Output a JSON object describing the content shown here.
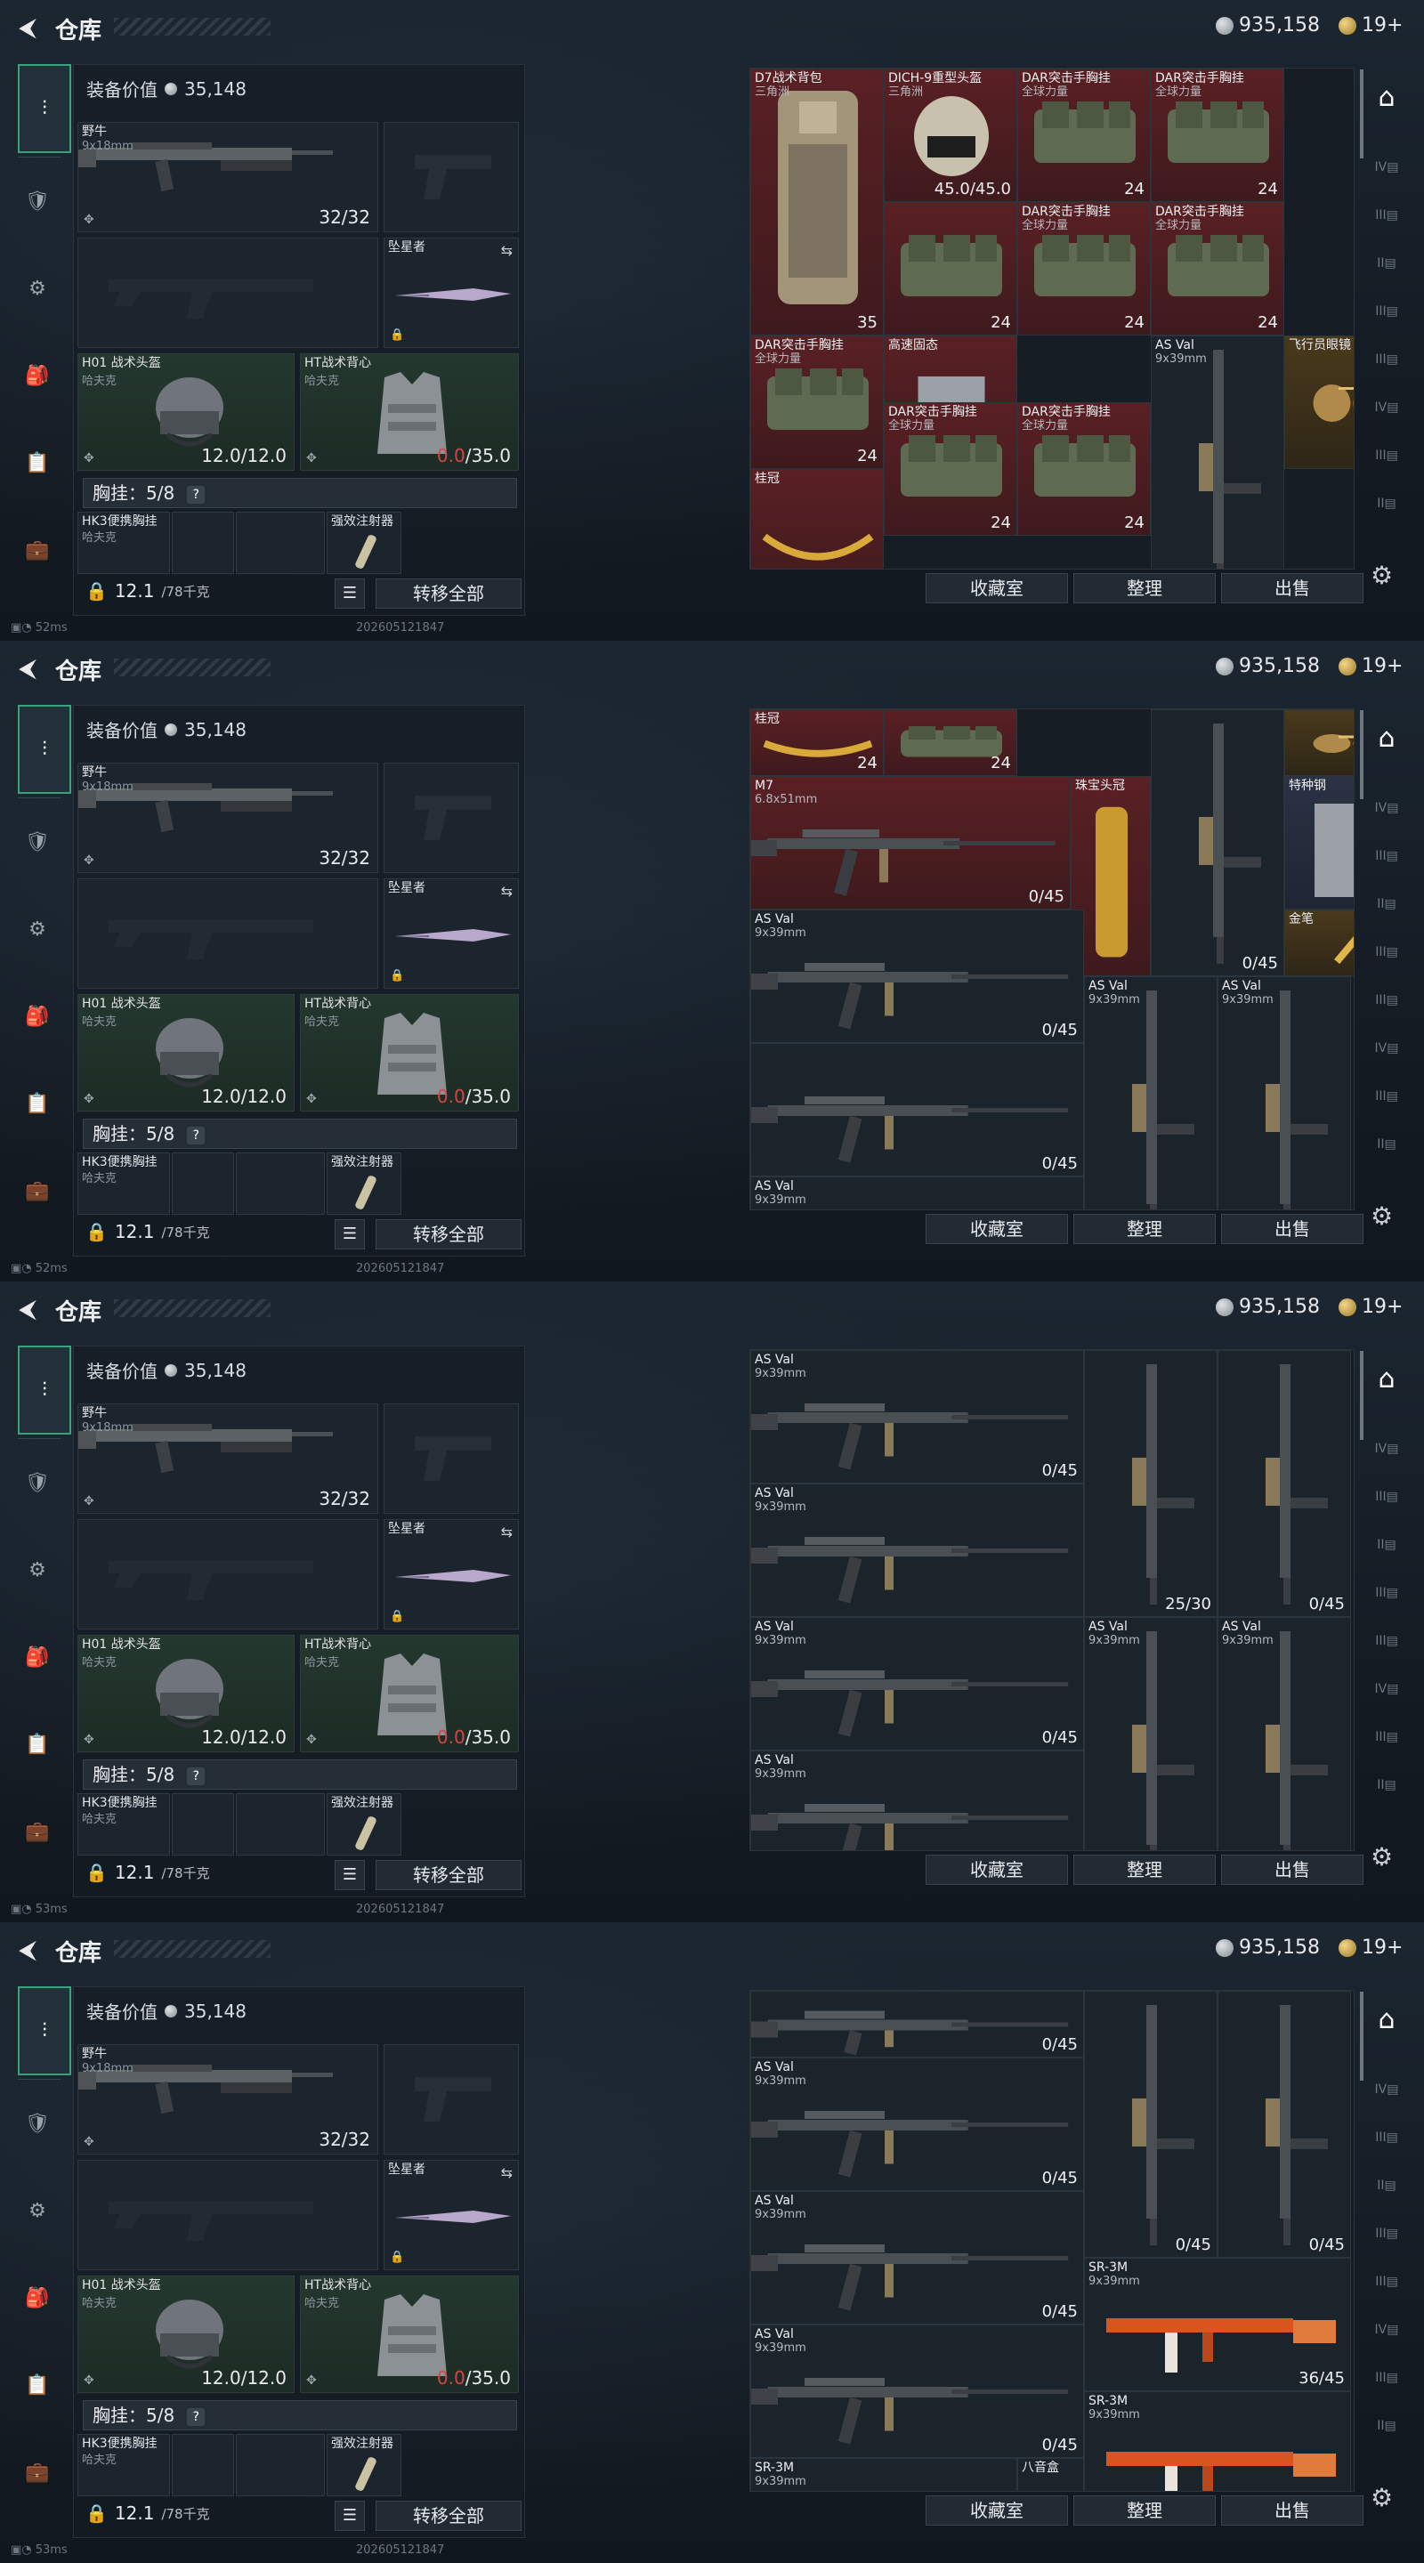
{
  "app": {
    "title": "仓库",
    "currency": "935,158",
    "tokens": "19+"
  },
  "left": {
    "value_label": "装备价值",
    "value": "35,148",
    "primary": {
      "name": "野牛",
      "caliber": "9x18mm",
      "ammo": "32/32"
    },
    "melee": {
      "name": "坠星者"
    },
    "helmet": {
      "name": "H01 战术头盔",
      "brand": "哈夫克",
      "dur": "12.0/12.0"
    },
    "armor": {
      "name": "HT战术背心",
      "brand": "哈夫克",
      "dur_cur": "0.0",
      "dur_max": "/35.0"
    },
    "rig": {
      "label": "胸挂：",
      "count": "5/8",
      "q": "?"
    },
    "rig_items": [
      {
        "name": "HK3便携胸挂",
        "brand": "哈夫克"
      },
      {
        "name": "强效注射器"
      }
    ],
    "weight": "12.1",
    "weight_max": "/78千克",
    "transfer_all": "转移全部"
  },
  "actions": {
    "collection": "收藏室",
    "sort": "整理",
    "sell": "出售"
  },
  "status": [
    {
      "ping": "52ms",
      "stamp": "202605121847"
    },
    {
      "ping": "52ms",
      "stamp": "202605121847"
    },
    {
      "ping": "53ms",
      "stamp": "202605121847"
    },
    {
      "ping": "53ms",
      "stamp": "202605121847"
    }
  ],
  "frames": [
    [
      {
        "c": 0,
        "r": 0,
        "w": 1,
        "h": 2,
        "n": "D7战术背包",
        "n2": "三角洲",
        "k": "red",
        "pic": "pack",
        "ct": "35"
      },
      {
        "c": 1,
        "r": 0,
        "w": 1,
        "h": 1,
        "n": "DICH-9重型头盔",
        "n2": "三角洲",
        "k": "red",
        "pic": "helmet",
        "ct": "45.0/45.0"
      },
      {
        "c": 2,
        "r": 0,
        "w": 1,
        "h": 1,
        "n": "DAR突击手胸挂",
        "n2": "全球力量",
        "k": "red",
        "pic": "bag",
        "ct": "24"
      },
      {
        "c": 3,
        "r": 0,
        "w": 1,
        "h": 1,
        "n": "DAR突击手胸挂",
        "n2": "全球力量",
        "k": "red",
        "pic": "bag",
        "ct": "24"
      },
      {
        "c": 2,
        "r": 1,
        "w": 1,
        "h": 1,
        "n": "DAR突击手胸挂",
        "n2": "全球力量",
        "k": "red",
        "pic": "bag",
        "ct": "24"
      },
      {
        "c": 3,
        "r": 1,
        "w": 1,
        "h": 1,
        "n": "DAR突击手胸挂",
        "n2": "全球力量",
        "k": "red",
        "pic": "bag",
        "ct": "24"
      },
      {
        "c": 1,
        "r": 1,
        "w": 1,
        "h": 1,
        "n": "",
        "n2": "",
        "k": "red",
        "pic": "bag",
        "ct": "24"
      },
      {
        "c": 0,
        "r": 2,
        "w": 1,
        "h": 1,
        "n": "DAR突击手胸挂",
        "n2": "全球力量",
        "k": "red",
        "pic": "bag",
        "ct": "24"
      },
      {
        "c": 1,
        "r": 2,
        "w": 1,
        "h": 1,
        "n": "高速固态",
        "n2": "",
        "k": "red",
        "pic": "drive",
        "ct": ""
      },
      {
        "c": 1,
        "r": 2.5,
        "w": 1,
        "h": 1,
        "n": "DAR突击手胸挂",
        "n2": "全球力量",
        "k": "red",
        "pic": "bag",
        "ct": "24"
      },
      {
        "c": 2,
        "r": 2.5,
        "w": 1,
        "h": 1,
        "n": "DAR突击手胸挂",
        "n2": "全球力量",
        "k": "red",
        "pic": "bag",
        "ct": "24"
      },
      {
        "c": 3,
        "r": 2,
        "w": 1,
        "h": 2,
        "n": "AS Val",
        "n2": "9x39mm",
        "k": "plain",
        "pic": "vgun",
        "ct": ""
      },
      {
        "c": 4,
        "r": 2,
        "w": 1,
        "h": 1,
        "n": "飞行员眼镜",
        "n2": "",
        "k": "gold",
        "pic": "glasses",
        "ct": ""
      },
      {
        "c": 0,
        "r": 3,
        "w": 1,
        "h": 1,
        "n": "桂冠",
        "n2": "",
        "k": "red",
        "pic": "crown",
        "ct": ""
      },
      {
        "c": 0,
        "r": 4,
        "w": 2.5,
        "h": 1,
        "n": "M7",
        "n2": "6.8x51mm",
        "k": "red",
        "pic": "gun",
        "ct": ""
      },
      {
        "c": 2.5,
        "r": 4,
        "w": 0.7,
        "h": 1,
        "n": "珠宝头冠",
        "n2": "",
        "k": "red",
        "pic": "crown2",
        "ct": ""
      },
      {
        "c": 4,
        "r": 4,
        "w": 1,
        "h": 1,
        "n": "特种钢",
        "n2": "",
        "k": "blue",
        "pic": "steel",
        "ct": ""
      }
    ],
    [
      {
        "c": 0,
        "r": 0,
        "w": 1,
        "h": 0.5,
        "n": "桂冠",
        "n2": "",
        "k": "red",
        "pic": "crown",
        "ct": "24"
      },
      {
        "c": 1,
        "r": 0,
        "w": 1,
        "h": 0.5,
        "n": "",
        "n2": "",
        "k": "red",
        "pic": "bag",
        "ct": "24"
      },
      {
        "c": 3,
        "r": 0,
        "w": 1,
        "h": 2,
        "n": "",
        "n2": "",
        "k": "plain",
        "pic": "vgun",
        "ct": "0/45"
      },
      {
        "c": 4,
        "r": 0,
        "w": 1,
        "h": 0.5,
        "n": "",
        "n2": "",
        "k": "gold",
        "pic": "glasses",
        "ct": ""
      },
      {
        "c": 0,
        "r": 0.5,
        "w": 2.4,
        "h": 1,
        "n": "M7",
        "n2": "6.8x51mm",
        "k": "red",
        "pic": "gun",
        "ct": "0/45"
      },
      {
        "c": 2.4,
        "r": 0.5,
        "w": 0.6,
        "h": 1.5,
        "n": "珠宝头冠",
        "n2": "",
        "k": "red",
        "pic": "crown2",
        "ct": ""
      },
      {
        "c": 4,
        "r": 0.5,
        "w": 1,
        "h": 1,
        "n": "特种钢",
        "n2": "",
        "k": "blue",
        "pic": "steel",
        "ct": ""
      },
      {
        "c": 4,
        "r": 1.5,
        "w": 1,
        "h": 0.5,
        "n": "金笔",
        "n2": "",
        "k": "gold",
        "pic": "pen",
        "ct": ""
      },
      {
        "c": 0,
        "r": 1.5,
        "w": 2.5,
        "h": 1,
        "n": "AS Val",
        "n2": "9x39mm",
        "k": "plain",
        "pic": "gun",
        "ct": "0/45"
      },
      {
        "c": 2.5,
        "r": 2,
        "w": 1,
        "h": 2,
        "n": "AS Val",
        "n2": "9x39mm",
        "k": "plain",
        "pic": "vgun",
        "ct": ""
      },
      {
        "c": 3.5,
        "r": 2,
        "w": 1,
        "h": 2,
        "n": "AS Val",
        "n2": "9x39mm",
        "k": "plain",
        "pic": "vgun",
        "ct": ""
      },
      {
        "c": 0,
        "r": 2.5,
        "w": 2.5,
        "h": 1,
        "n": "",
        "n2": "",
        "k": "plain",
        "pic": "gun",
        "ct": "0/45"
      },
      {
        "c": 0,
        "r": 3.5,
        "w": 2.5,
        "h": 1,
        "n": "AS Val",
        "n2": "9x39mm",
        "k": "plain",
        "pic": "gun",
        "ct": ""
      }
    ],
    [
      {
        "c": 0,
        "r": 0,
        "w": 2.5,
        "h": 1,
        "n": "AS Val",
        "n2": "9x39mm",
        "k": "plain",
        "pic": "gun",
        "ct": "0/45"
      },
      {
        "c": 2.5,
        "r": 0,
        "w": 1,
        "h": 2,
        "n": "",
        "n2": "",
        "k": "plain",
        "pic": "vgun",
        "ct": "25/30"
      },
      {
        "c": 3.5,
        "r": 0,
        "w": 1,
        "h": 2,
        "n": "",
        "n2": "",
        "k": "plain",
        "pic": "vgun",
        "ct": "0/45"
      },
      {
        "c": 0,
        "r": 1,
        "w": 2.5,
        "h": 1,
        "n": "AS Val",
        "n2": "9x39mm",
        "k": "plain",
        "pic": "gun",
        "ct": ""
      },
      {
        "c": 0,
        "r": 2,
        "w": 2.5,
        "h": 1,
        "n": "AS Val",
        "n2": "9x39mm",
        "k": "plain",
        "pic": "gun",
        "ct": "0/45"
      },
      {
        "c": 2.5,
        "r": 2,
        "w": 1,
        "h": 2,
        "n": "AS Val",
        "n2": "9x39mm",
        "k": "plain",
        "pic": "vgun",
        "ct": ""
      },
      {
        "c": 3.5,
        "r": 2,
        "w": 1,
        "h": 2,
        "n": "AS Val",
        "n2": "9x39mm",
        "k": "plain",
        "pic": "vgun",
        "ct": ""
      },
      {
        "c": 0,
        "r": 3,
        "w": 2.5,
        "h": 1,
        "n": "AS Val",
        "n2": "9x39mm",
        "k": "plain",
        "pic": "gun",
        "ct": ""
      }
    ],
    [
      {
        "c": 0,
        "r": 0,
        "w": 2.5,
        "h": 0.5,
        "n": "",
        "n2": "",
        "k": "plain",
        "pic": "gun",
        "ct": "0/45"
      },
      {
        "c": 2.5,
        "r": 0,
        "w": 1,
        "h": 2,
        "n": "",
        "n2": "",
        "k": "plain",
        "pic": "vgun",
        "ct": "0/45"
      },
      {
        "c": 3.5,
        "r": 0,
        "w": 1,
        "h": 2,
        "n": "",
        "n2": "",
        "k": "plain",
        "pic": "vgun",
        "ct": "0/45"
      },
      {
        "c": 0,
        "r": 0.5,
        "w": 2.5,
        "h": 1,
        "n": "AS Val",
        "n2": "9x39mm",
        "k": "plain",
        "pic": "gun",
        "ct": "0/45"
      },
      {
        "c": 0,
        "r": 1.5,
        "w": 2.5,
        "h": 1,
        "n": "AS Val",
        "n2": "9x39mm",
        "k": "plain",
        "pic": "gun",
        "ct": "0/45"
      },
      {
        "c": 2.5,
        "r": 2,
        "w": 2,
        "h": 1,
        "n": "SR-3M",
        "n2": "9x39mm",
        "k": "plain",
        "pic": "orange",
        "ct": "36/45"
      },
      {
        "c": 0,
        "r": 2.5,
        "w": 2.5,
        "h": 1,
        "n": "AS Val",
        "n2": "9x39mm",
        "k": "plain",
        "pic": "gun",
        "ct": "0/45"
      },
      {
        "c": 2.5,
        "r": 3,
        "w": 2,
        "h": 1,
        "n": "SR-3M",
        "n2": "9x39mm",
        "k": "plain",
        "pic": "orange",
        "ct": ""
      },
      {
        "c": 0,
        "r": 3.5,
        "w": 2,
        "h": 1,
        "n": "SR-3M",
        "n2": "9x39mm",
        "k": "plain",
        "pic": "gun",
        "ct": ""
      },
      {
        "c": 2,
        "r": 3.5,
        "w": 0.5,
        "h": 1,
        "n": "八音盒",
        "n2": "",
        "k": "plain",
        "pic": "drive",
        "ct": ""
      }
    ]
  ],
  "icons": {
    "back": "back-arrow-icon",
    "coin": "coin-icon",
    "gold": "gold-token-icon",
    "settings": "gear-icon",
    "lock": "lock-icon",
    "list": "list-icon",
    "count": "grid-count-icon"
  }
}
